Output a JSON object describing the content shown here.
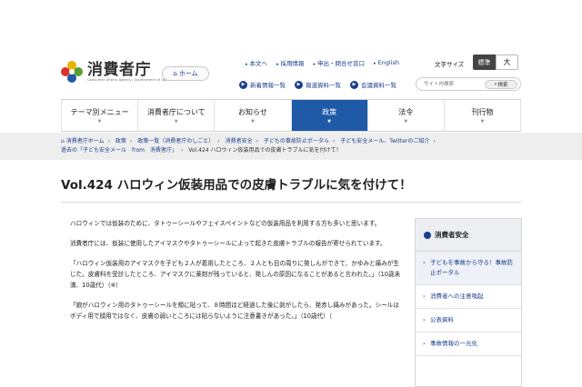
{
  "header": {
    "logo_main": "消費者庁",
    "logo_sub": "Consumer Affairs Agency, Government of Japan",
    "home_label": "ホーム",
    "util_links": [
      "本文へ",
      "採用情報",
      "申出・問合せ窓口",
      "English"
    ],
    "font_size_label": "文字サイズ",
    "font_std": "標準",
    "font_big": "大",
    "sub_links": [
      "新着情報一覧",
      "報道資料一覧",
      "会議資料一覧"
    ],
    "search_placeholder": "サイト内検索",
    "search_button": "検索"
  },
  "gnav": [
    {
      "label": "テーマ別メニュー",
      "active": false
    },
    {
      "label": "消費者庁について",
      "active": false
    },
    {
      "label": "お知らせ",
      "active": false
    },
    {
      "label": "政策",
      "active": true
    },
    {
      "label": "法令",
      "active": false
    },
    {
      "label": "刊行物",
      "active": false
    }
  ],
  "breadcrumb": {
    "items": [
      "消費者庁ホーム",
      "政策",
      "政策一覧（消費者庁のしごと）",
      "消費者安全",
      "子どもの事故防止ポータル",
      "子ども安全メール、Twitterのご紹介",
      "過去の「子ども安全メール　from　消費者庁」"
    ],
    "current": "Vol.424 ハロウィン仮装用品での皮膚トラブルに気を付けて！"
  },
  "page_title": "Vol.424 ハロウィン仮装用品での皮膚トラブルに気を付けて！",
  "body": {
    "p1": "ハロウィンでは仮装のために、タトゥーシールやフェイスペイントなどの仮装用品を利用する方も多いと思います。",
    "p2": "消費者庁には、仮装に使用したアイマスクやタトゥーシールによって起きた皮膚トラブルの報告が寄せられています。",
    "p3": "「ハロウィン仮装用のアイマスクを子ども２人が着用したところ、２人とも目の周りに発しんができて、かゆみと痛みが生じた。皮膚科を受診したところ、アイマスクに薬剤が残っていると、発しんの原因になることがあると言われた。」（10歳未満、10歳代）（※）",
    "p4": "「娘がハロウィン用のタトゥーシールを頬に貼って、８時間ほど経過した後に剥がしたら、発赤し痛みがあった。シールはボディ用で顔用ではなく、皮膚の弱いところには貼らないように注意書きがあった。」（10歳代）（"
  },
  "side": {
    "heading": "消費者安全",
    "items": [
      "子どもを事故から守る！事故防止ポータル",
      "消費者への注意喚起",
      "公表資料",
      "事故情報の一元化"
    ]
  },
  "colors": {
    "brand": "#1e5aa8",
    "link": "#1a3e8c"
  }
}
